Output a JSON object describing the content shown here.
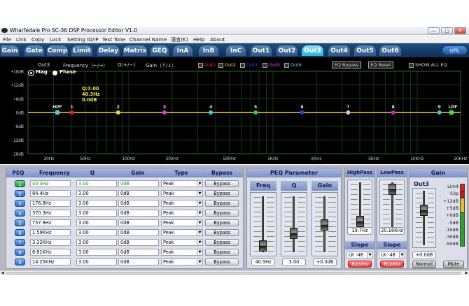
{
  "window": {
    "title": "Wharfedale Pro SC-36 DSP Processor Editor V1.0",
    "min": "—",
    "max": "□",
    "close": "✕"
  },
  "menu": [
    "File",
    "Link",
    "Copy",
    "Lock",
    "Setting ID/IP",
    "Test Tone",
    "Channel Name",
    "语言(K)",
    "Help",
    "About"
  ],
  "tabs": [
    "Gain",
    "Gate",
    "Comp",
    "Limit",
    "Delay",
    "Matrix",
    "GEQ",
    "InA",
    "InB",
    "InC",
    "Out1",
    "Out2",
    "Out3",
    "Out4",
    "Out5",
    "Out6"
  ],
  "active_tab": "Out3",
  "off_button": "OffL",
  "graph": {
    "channel": "Out3",
    "freq_hint": "Frequency（←/→）",
    "q_hint": "Q(+/−)",
    "gain_hint": "Gain（↑/↓）",
    "legend": [
      {
        "label": "Out1",
        "color": "#ff3030"
      },
      {
        "label": "Out2",
        "color": "#e0e040"
      },
      {
        "label": "Out3",
        "color": "#4040ff"
      },
      {
        "label": "Out4",
        "color": "#ff40ff"
      },
      {
        "label": "Out5",
        "color": "#ff40ff"
      },
      {
        "label": "Out6",
        "color": "#40e0e0"
      }
    ],
    "eq_bypass": "EQ Bypass",
    "eq_reset": "EQ Reset",
    "show_all": "SHOW ALL EQ",
    "mag": "Mag",
    "phase": "Phase",
    "hpf": "HPF",
    "lpf": "LPF",
    "tooltip": {
      "q": "Q:3.00",
      "freq": "40.3Hz",
      "gain": "0.0dB"
    }
  },
  "chart_data": {
    "type": "line",
    "xscale": "log",
    "xlim": [
      20,
      20000
    ],
    "ylim": [
      -18,
      18
    ],
    "yticks": [
      "+18dB",
      "+12dB",
      "+6dB",
      "0dB",
      "-6dB",
      "-12dB",
      "-18dB"
    ],
    "xticks": [
      {
        "label": "20Hz",
        "value": 20
      },
      {
        "label": "50Hz",
        "value": 50
      },
      {
        "label": "100Hz",
        "value": 100
      },
      {
        "label": "200Hz",
        "value": 200
      },
      {
        "label": "500Hz",
        "value": 500
      },
      {
        "label": "1KHz",
        "value": 1000
      },
      {
        "label": "2KHz",
        "value": 2000
      },
      {
        "label": "5KHz",
        "value": 5000
      },
      {
        "label": "10KHz",
        "value": 10000
      },
      {
        "label": "20KHz",
        "value": 20000
      }
    ],
    "series": [
      {
        "name": "Out3",
        "values": [
          [
            20,
            0
          ],
          [
            20000,
            0
          ]
        ]
      }
    ],
    "points": [
      {
        "label": "HPF",
        "freq": 19.7,
        "gain": 0,
        "color": "#3ad0e8"
      },
      {
        "label": "1",
        "freq": 40.3,
        "gain": 0,
        "color": "#e02020"
      },
      {
        "label": "2",
        "freq": 84.4,
        "gain": 0,
        "color": "#e8e020"
      },
      {
        "label": "3",
        "freq": 176.8,
        "gain": 0,
        "color": "#e030e0"
      },
      {
        "label": "4",
        "freq": 370.3,
        "gain": 0,
        "color": "#30d0e8"
      },
      {
        "label": "5",
        "freq": 757.9,
        "gain": 0,
        "color": "#30d030"
      },
      {
        "label": "6",
        "freq": 1590,
        "gain": 0,
        "color": "#2040e0"
      },
      {
        "label": "7",
        "freq": 3320,
        "gain": 0,
        "color": "#c8d0e8"
      },
      {
        "label": "8",
        "freq": 6810,
        "gain": 0,
        "color": "#c020c0"
      },
      {
        "label": "9",
        "freq": 14250,
        "gain": 0,
        "color": "#30c8c8"
      },
      {
        "label": "LPF",
        "freq": 20160,
        "gain": 0,
        "color": "#40e040"
      }
    ]
  },
  "peq": {
    "headers": [
      "PEQ",
      "Frequency",
      "Q",
      "Gain",
      "Type",
      "Bypass"
    ],
    "rows": [
      {
        "n": "1",
        "freq": "40.3Hz",
        "q": "3.00",
        "gain": "0dB",
        "type": "Peak",
        "bypass": "Bypass"
      },
      {
        "n": "2",
        "freq": "84.4Hz",
        "q": "3.00",
        "gain": "0dB",
        "type": "Peak",
        "bypass": "Bypass"
      },
      {
        "n": "3",
        "freq": "176.8Hz",
        "q": "3.00",
        "gain": "0dB",
        "type": "Peak",
        "bypass": "Bypass"
      },
      {
        "n": "4",
        "freq": "370.3Hz",
        "q": "3.00",
        "gain": "0dB",
        "type": "Peak",
        "bypass": "Bypass"
      },
      {
        "n": "5",
        "freq": "757.9Hz",
        "q": "3.00",
        "gain": "0dB",
        "type": "Peak",
        "bypass": "Bypass"
      },
      {
        "n": "6",
        "freq": "1.59KHz",
        "q": "3.00",
        "gain": "0dB",
        "type": "Peak",
        "bypass": "Bypass"
      },
      {
        "n": "7",
        "freq": "3.32KHz",
        "q": "3.00",
        "gain": "0dB",
        "type": "Peak",
        "bypass": "Bypass"
      },
      {
        "n": "8",
        "freq": "6.81KHz",
        "q": "3.00",
        "gain": "0dB",
        "type": "Peak",
        "bypass": "Bypass"
      },
      {
        "n": "9",
        "freq": "14.25KHz",
        "q": "3.00",
        "gain": "0dB",
        "type": "Peak",
        "bypass": "Bypass"
      }
    ]
  },
  "peq_param": {
    "title": "PEQ Parameter",
    "freq_label": "Freq",
    "q_label": "Q",
    "gain_label": "Gain",
    "freq": "40.3Hz",
    "q": "3.00",
    "gain": "+0.0dB"
  },
  "highpass": {
    "title": "HighPass",
    "value": "19.7Hz",
    "slope_label": "Slope",
    "slope": "LK -48",
    "bypass": "Bypass"
  },
  "lowpass": {
    "title": "LowPass",
    "value": "20.16KHz",
    "slope_label": "Slope",
    "slope": "LK -48",
    "bypass": "Bypass"
  },
  "gain_panel": {
    "title": "Gain",
    "channel": "Out3",
    "value": "+0.0dB",
    "normal": "Normal",
    "mute": "Mute",
    "meter_labels": [
      "Limit",
      "Clip",
      "+12dB",
      "+5dB",
      "+0dB",
      "-5dB",
      "-10dB",
      "-30dB",
      "-50dB"
    ]
  }
}
